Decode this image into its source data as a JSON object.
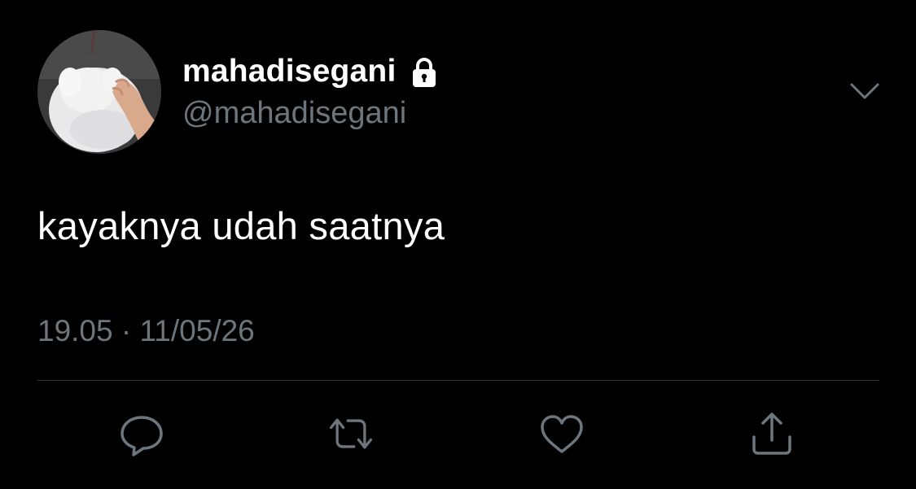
{
  "user": {
    "display_name": "mahadisegani",
    "handle": "@mahadisegani",
    "protected_icon": "lock-icon",
    "avatar": "avatar-white-dog-photo"
  },
  "tweet": {
    "text": "kayaknya udah saatnya",
    "timestamp": "19.05 · 11/05/26"
  },
  "actions": [
    {
      "name": "reply",
      "icon": "comment-bubble-icon"
    },
    {
      "name": "retweet",
      "icon": "retweet-icon"
    },
    {
      "name": "like",
      "icon": "heart-icon"
    },
    {
      "name": "share",
      "icon": "share-icon"
    }
  ],
  "menu": {
    "icon": "chevron-down-icon"
  },
  "colors": {
    "background": "#000000",
    "primary_text": "#ffffff",
    "secondary_text": "#6e767d",
    "icon_color": "#6e767d",
    "divider": "#2f3336"
  }
}
